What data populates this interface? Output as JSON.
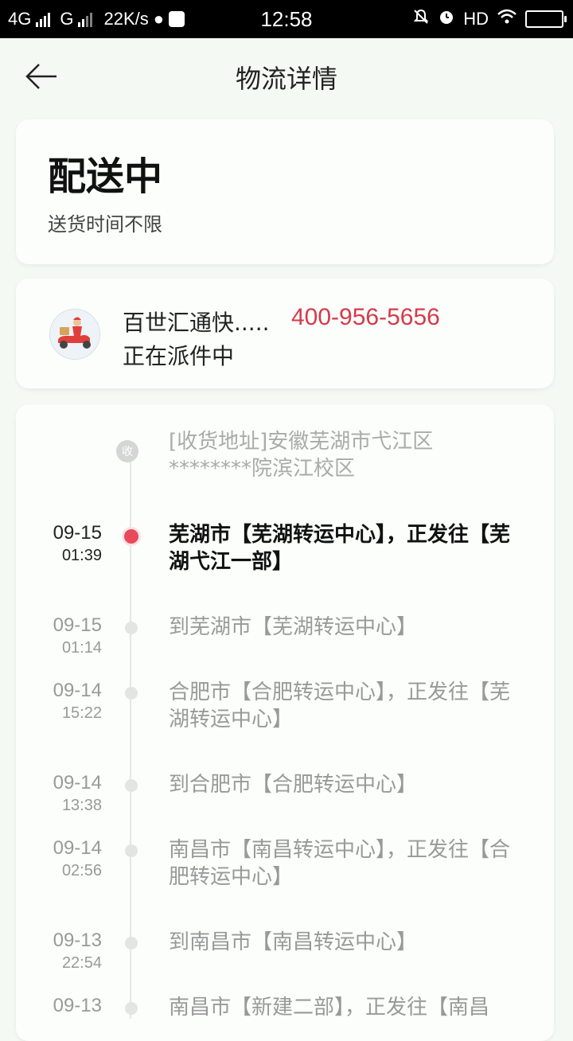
{
  "status_bar": {
    "network1": "4G",
    "network2": "G",
    "speed": "22K/s",
    "time": "12:58",
    "hd": "HD"
  },
  "header": {
    "title": "物流详情"
  },
  "status_card": {
    "status": "配送中",
    "delivery_time": "送货时间不限"
  },
  "courier": {
    "name": "百世汇通快.....",
    "phone": "400-956-5656",
    "status": "正在派件中"
  },
  "receive_badge": "收",
  "address": {
    "line1": "[收货地址]安徽芜湖市弋江区",
    "line2": "********院滨江校区"
  },
  "timeline": [
    {
      "date": "09-15",
      "time": "01:39",
      "desc": "芜湖市【芜湖转运中心】，正发往【芜湖弋江一部】"
    },
    {
      "date": "09-15",
      "time": "01:14",
      "desc": "到芜湖市【芜湖转运中心】"
    },
    {
      "date": "09-14",
      "time": "15:22",
      "desc": "合肥市【合肥转运中心】，正发往【芜湖转运中心】"
    },
    {
      "date": "09-14",
      "time": "13:38",
      "desc": "到合肥市【合肥转运中心】"
    },
    {
      "date": "09-14",
      "time": "02:56",
      "desc": "南昌市【南昌转运中心】，正发往【合肥转运中心】"
    },
    {
      "date": "09-13",
      "time": "22:54",
      "desc": "到南昌市【南昌转运中心】"
    },
    {
      "date": "09-13",
      "time": "",
      "desc": "南昌市【新建二部】，正发往【南昌"
    }
  ],
  "colors": {
    "accent": "#d63a4a",
    "active_dot": "#e84a5a",
    "background": "#f4f9f4"
  }
}
